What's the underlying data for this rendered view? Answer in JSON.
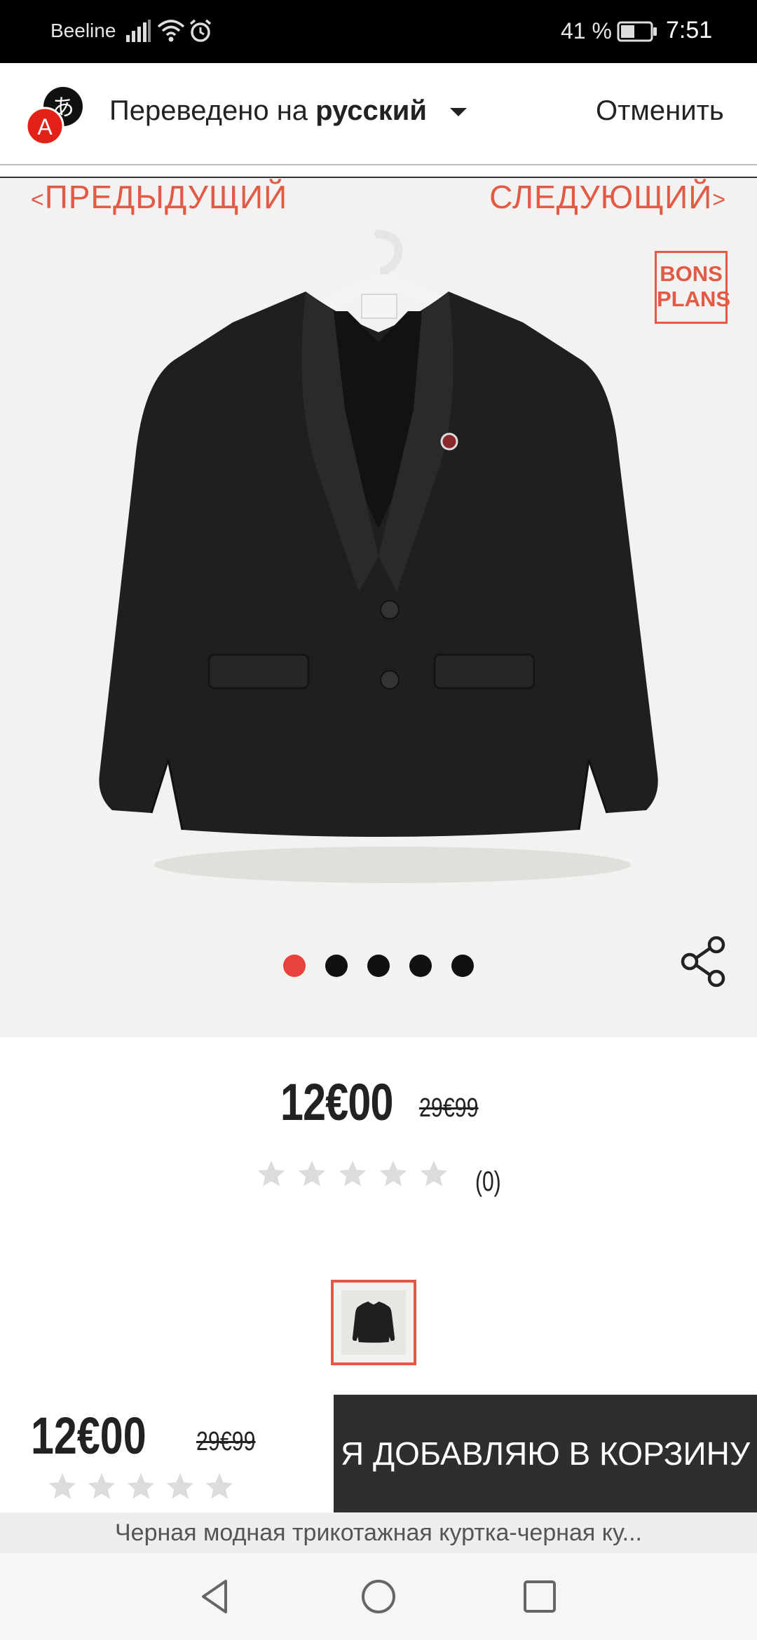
{
  "status_bar": {
    "carrier": "Beeline",
    "battery_percent": "41 %",
    "time": "7:51",
    "icons": [
      "signal-icon",
      "wifi-icon",
      "alarm-icon",
      "battery-icon"
    ]
  },
  "translate_bar": {
    "prefix": "Переведено на ",
    "language": "русский",
    "cancel_label": "Отменить",
    "icon": "translate-icon"
  },
  "gallery": {
    "prev_label": "ПРЕДЫДУЩИЙ",
    "next_label": "СЛЕДУЮЩИЙ",
    "prev_chevron": "<",
    "next_chevron": ">",
    "badge_line1": "BONS",
    "badge_line2": "PLANS",
    "dots_total": 5,
    "active_dot": 1,
    "share_icon": "share-icon"
  },
  "product": {
    "price": "12€00",
    "old_price": "29€99",
    "rating": 0,
    "rating_max": 5,
    "review_count": "(0)"
  },
  "buy_bar": {
    "price": "12€00",
    "old_price": "29€99",
    "add_to_cart_label": "Я ДОБАВЛЯЮ В КОРЗИНУ"
  },
  "caption": "Черная модная трикотажная куртка-черная ку...",
  "colors": {
    "accent": "#e05a45",
    "active_dot": "#e8423d",
    "cart_button": "#2e2e2e"
  }
}
